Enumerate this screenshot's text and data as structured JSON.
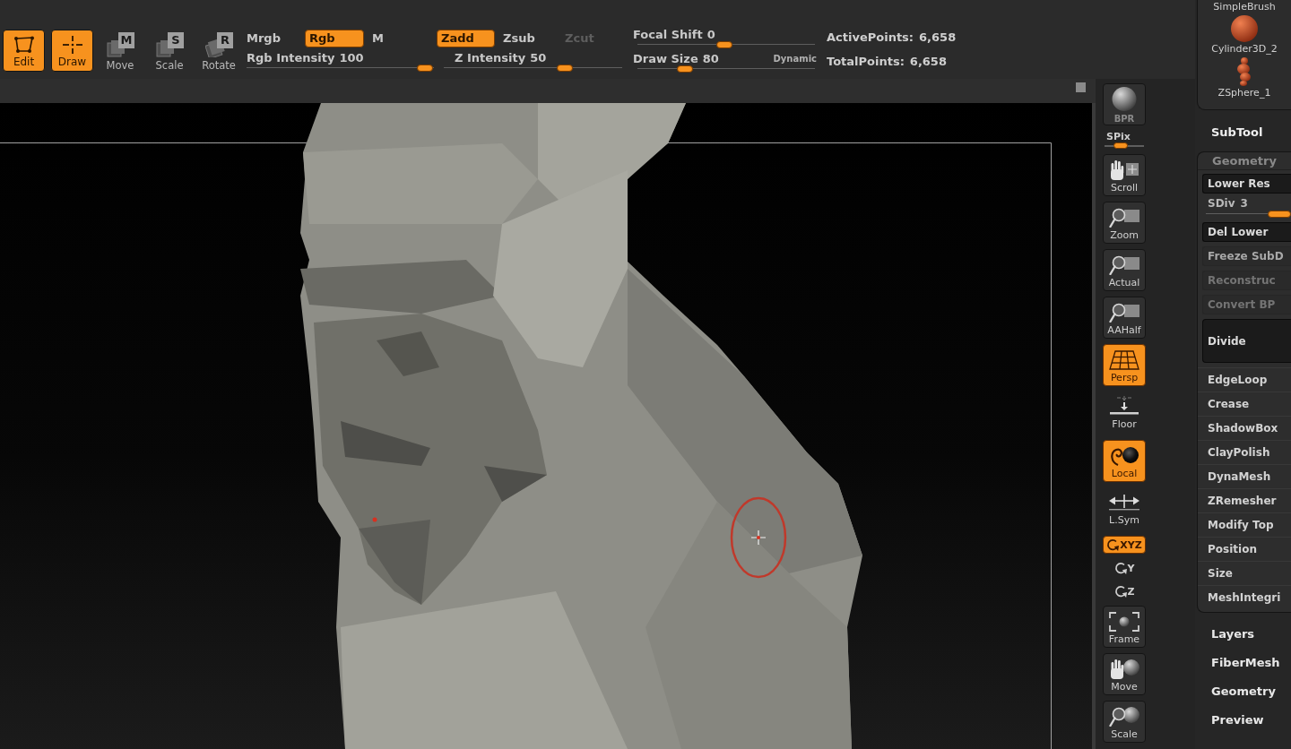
{
  "toolbar": {
    "modes": [
      {
        "label": "Edit",
        "selected": true
      },
      {
        "label": "Draw",
        "selected": true
      }
    ],
    "transforms": [
      {
        "label": "Move",
        "key": "M",
        "selected": false
      },
      {
        "label": "Scale",
        "key": "S",
        "selected": false
      },
      {
        "label": "Rotate",
        "key": "R",
        "selected": false
      }
    ],
    "color_modes": [
      {
        "label": "Mrgb",
        "selected": false
      },
      {
        "label": "Rgb",
        "selected": true
      },
      {
        "label": "M",
        "selected": false
      }
    ],
    "rgb_intensity": {
      "label": "Rgb Intensity",
      "value": "100",
      "level": 0.95
    },
    "depth_modes": [
      {
        "label": "Zadd",
        "selected": true,
        "disabled": false
      },
      {
        "label": "Zsub",
        "selected": false,
        "disabled": false
      },
      {
        "label": "Zcut",
        "selected": false,
        "disabled": true
      }
    ],
    "z_intensity": {
      "label": "Z Intensity",
      "value": "50",
      "level": 0.68
    },
    "focal_shift": {
      "label": "Focal Shift",
      "value": "0",
      "level": 0.49
    },
    "draw_size": {
      "label": "Draw Size",
      "value": "80",
      "level": 0.27
    },
    "dynamic": {
      "label": "Dynamic"
    },
    "stats": [
      {
        "label": "ActivePoints:",
        "value": "6,658"
      },
      {
        "label": "TotalPoints:",
        "value": "6,658"
      }
    ]
  },
  "view_controls": {
    "bpr": {
      "label": "BPR",
      "selected": false
    },
    "spix": {
      "label": "SPix",
      "level": 0.4
    },
    "buttons": [
      {
        "label": "Scroll",
        "kind": "button",
        "selected": false
      },
      {
        "label": "Zoom",
        "kind": "button",
        "selected": false
      },
      {
        "label": "Actual",
        "kind": "button",
        "selected": false
      },
      {
        "label": "AAHalf",
        "kind": "button",
        "selected": false
      },
      {
        "label": "Persp",
        "kind": "button",
        "selected": true
      },
      {
        "label": "Floor",
        "kind": "flat",
        "selected": false
      },
      {
        "label": "Local",
        "kind": "button",
        "selected": true
      },
      {
        "label": "L.Sym",
        "kind": "flat",
        "selected": false
      },
      {
        "label": "XYZ",
        "kind": "axis",
        "selected": true
      },
      {
        "label": "Y",
        "kind": "axis",
        "selected": false
      },
      {
        "label": "Z",
        "kind": "axis",
        "selected": false
      },
      {
        "label": "Frame",
        "kind": "button",
        "selected": false
      },
      {
        "label": "Move",
        "kind": "button",
        "selected": false
      },
      {
        "label": "Scale",
        "kind": "button",
        "selected": false
      }
    ]
  },
  "tool_panel": {
    "subtools": [
      {
        "label": "SimpleBrush",
        "kind": "brush"
      },
      {
        "label": "Cylinder3D_2",
        "kind": "cylinder"
      },
      {
        "label": "ZSphere_1",
        "kind": "zsphere"
      }
    ],
    "subtool_title": "SubTool",
    "geometry": {
      "title": "Geometry",
      "items": [
        {
          "kind": "button",
          "label": "Lower Res",
          "disabled": false
        },
        {
          "kind": "slider",
          "label": "SDiv",
          "value": "3",
          "level": 0.86,
          "disabled": false
        },
        {
          "kind": "button",
          "label": "Del Lower",
          "disabled": false
        },
        {
          "kind": "flat",
          "label": "Freeze SubD",
          "disabled": false
        },
        {
          "kind": "flat",
          "label": "Reconstruc",
          "disabled": true
        },
        {
          "kind": "flat",
          "label": "Convert BP",
          "disabled": true
        },
        {
          "kind": "large",
          "label": "Divide",
          "disabled": false
        },
        {
          "kind": "section",
          "label": "EdgeLoop",
          "disabled": false
        },
        {
          "kind": "section",
          "label": "Crease",
          "disabled": false
        },
        {
          "kind": "section",
          "label": "ShadowBox",
          "disabled": false
        },
        {
          "kind": "section",
          "label": "ClayPolish",
          "disabled": false
        },
        {
          "kind": "section",
          "label": "DynaMesh",
          "disabled": false
        },
        {
          "kind": "section",
          "label": "ZRemesher",
          "disabled": false
        },
        {
          "kind": "section",
          "label": "Modify Top",
          "disabled": false
        },
        {
          "kind": "section",
          "label": "Position",
          "disabled": false
        },
        {
          "kind": "section",
          "label": "Size",
          "disabled": false
        },
        {
          "kind": "section",
          "label": "MeshIntegri",
          "disabled": false
        }
      ]
    },
    "palettes": [
      {
        "label": "Layers"
      },
      {
        "label": "FiberMesh"
      },
      {
        "label": "Geometry"
      },
      {
        "label": "Preview"
      }
    ]
  }
}
